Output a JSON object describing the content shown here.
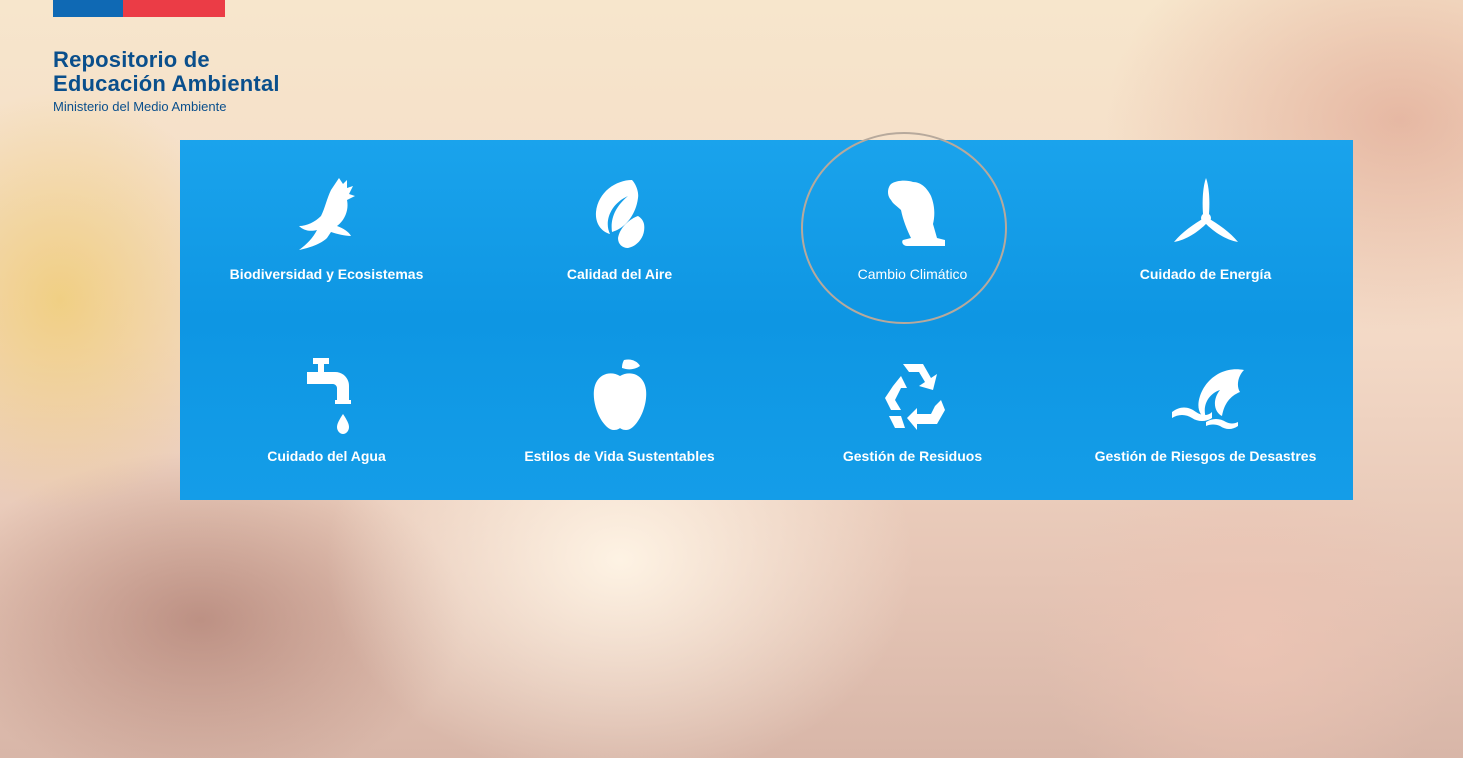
{
  "header": {
    "title_line1": "Repositorio de",
    "title_line2": "Educación Ambiental",
    "subtitle": "Ministerio del Medio Ambiente",
    "stripe_colors": [
      "#0f69b4",
      "#eb3c46"
    ]
  },
  "categories": [
    {
      "label": "Biodiversidad y Ecosistemas",
      "icon": "condor-icon"
    },
    {
      "label": "Calidad del Aire",
      "icon": "leaves-icon"
    },
    {
      "label": "Cambio Climático",
      "icon": "polar-bear-icon"
    },
    {
      "label": "Cuidado de Energía",
      "icon": "wind-turbine-icon"
    },
    {
      "label": "Cuidado del Agua",
      "icon": "faucet-icon"
    },
    {
      "label": "Estilos de Vida Sustentables",
      "icon": "apple-icon"
    },
    {
      "label": "Gestión de Residuos",
      "icon": "recycle-icon"
    },
    {
      "label": "Gestión de Riesgos de Desastres",
      "icon": "wave-icon"
    }
  ],
  "colors": {
    "panel_blue": "#0e96e3",
    "brand_blue": "#0a4f8c"
  }
}
